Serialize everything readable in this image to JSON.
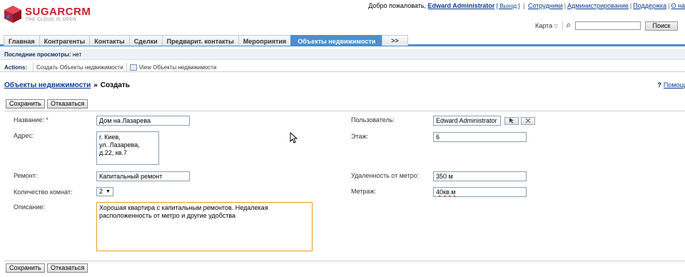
{
  "brand": {
    "name_a": "SUGAR",
    "name_b": "CRM",
    "tagline": "THE CLOUD IS OPEN"
  },
  "topbar": {
    "welcome": "Добро пожаловать,",
    "user": "Edward Administrator",
    "logout": "[ Выход ]",
    "links": [
      "Сотрудники",
      "Администрирование",
      "Поддержка",
      "О на"
    ]
  },
  "search": {
    "map_label": "Карта",
    "value": "",
    "button": "Поиск"
  },
  "tabs": [
    "Главная",
    "Контрагенты",
    "Контакты",
    "Сделки",
    "Предварит. контакты",
    "Мероприятия",
    "Объекты недвижимости",
    ">>"
  ],
  "active_tab": "Объекты недвижимости",
  "last_viewed": {
    "label": "Последние просмотры:",
    "value": "нет"
  },
  "actions": {
    "label": "Actions:",
    "create": "Создать Объекты недвижимости",
    "view": "View Объекты недвижимости"
  },
  "breadcrumb": {
    "module": "Объекты недвижимости",
    "arrow": "»",
    "page": "Создать"
  },
  "help": {
    "q": "?",
    "label": "Помощ"
  },
  "buttons": {
    "save": "Сохранить",
    "cancel": "Отказаться"
  },
  "form": {
    "name_label": "Название:",
    "name_required": "*",
    "name_value": "Дом на Лазарева",
    "address_label": "Адрес:",
    "address_value": "г. Киев,\nул. Лазарева,\nд.22, кв.7",
    "repair_label": "Ремонт:",
    "repair_value": "Капитальный ремонт",
    "rooms_label": "Количество комнат:",
    "rooms_value": "2",
    "desc_label": "Описание:",
    "desc_value": "Хорошая квартира с капитальным ремонтов. Недалекая\nрасположенность от метро и другие удобства",
    "user_label": "Пользователь:",
    "user_value": "Edward Administrator",
    "floor_label": "Этаж:",
    "floor_value": "6",
    "metro_label": "Удаленность от метро:",
    "metro_value": "350 м",
    "area_label": "Метраж:",
    "area_value": "40кв.м"
  },
  "colors": {
    "accent": "#4a8fcf",
    "brand_red": "#cc1e2c",
    "link": "#0b3d8f",
    "required": "#e01010",
    "focus_border": "#e0a020"
  }
}
